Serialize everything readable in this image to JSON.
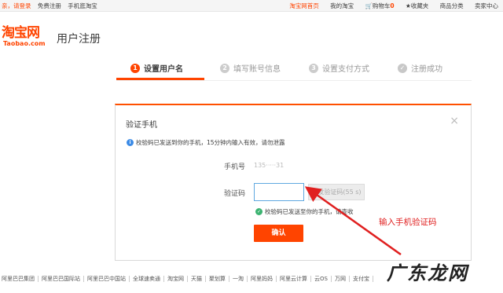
{
  "topbar": {
    "greeting": "亲，请登录",
    "register": "免费注册",
    "mobile": "手机逛淘宝",
    "home": "淘宝网首页",
    "my_taobao": "我的淘宝",
    "cart_label": "购物车",
    "cart_count": "0",
    "favorites": "收藏夹",
    "categories": "商品分类",
    "seller_center": "卖家中心"
  },
  "header": {
    "logo_cn": "淘宝网",
    "logo_en": "Taobao.com",
    "title": "用户注册"
  },
  "steps": [
    {
      "num": "1",
      "label": "设置用户名"
    },
    {
      "num": "2",
      "label": "填写账号信息"
    },
    {
      "num": "3",
      "label": "设置支付方式"
    },
    {
      "num": "✓",
      "label": "注册成功"
    }
  ],
  "dialog": {
    "title": "验证手机",
    "close": "×",
    "notice": "校验码已发送到你的手机，15分钟内输入有效，请勿泄露",
    "phone_label": "手机号",
    "phone_value": "135·····31",
    "code_label": "验证码",
    "code_value": "",
    "resend": "重发验证码(55 s)",
    "sent_msg": "校验码已发送至你的手机，请查收",
    "confirm": "确认"
  },
  "annotation": "输入手机验证码",
  "footer": [
    "阿里巴巴集团",
    "阿里巴巴国际站",
    "阿里巴巴中国站",
    "全球速卖通",
    "淘宝网",
    "天猫",
    "聚划算",
    "一淘",
    "阿里妈妈",
    "阿里云计算",
    "云OS",
    "万网",
    "支付宝"
  ],
  "watermark": "广东龙网",
  "colors": {
    "brand": "#ff4400",
    "annotation": "#e02020",
    "focus": "#5fa8e0"
  }
}
